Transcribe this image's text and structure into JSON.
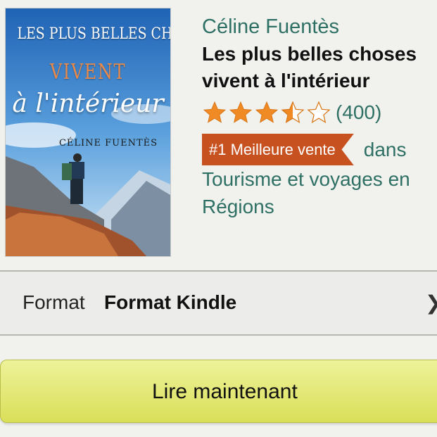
{
  "product": {
    "cover": {
      "series_line": "LES PLUS BELLES CHOSES",
      "line2": "VIVENT",
      "line3": "à l'intérieur",
      "author": "CÉLINE FUENTÈS"
    },
    "author": "Céline Fuentès",
    "title_line1": "Les plus belles choses",
    "title_line2": "vivent à l'intérieur",
    "rating": {
      "stars": 3.5,
      "max": 5,
      "count": "(400)"
    },
    "badge": "#1 Meilleure vente",
    "category_prefix": "dans",
    "category_line1": "Tourisme et voyages en",
    "category_line2": "Régions"
  },
  "format": {
    "label": "Format",
    "value": "Format Kindle"
  },
  "action": {
    "read_now": "Lire maintenant"
  },
  "colors": {
    "link": "#2e7064",
    "badge": "#c7511f",
    "star": "#f08a24",
    "button": "#e3e878"
  }
}
